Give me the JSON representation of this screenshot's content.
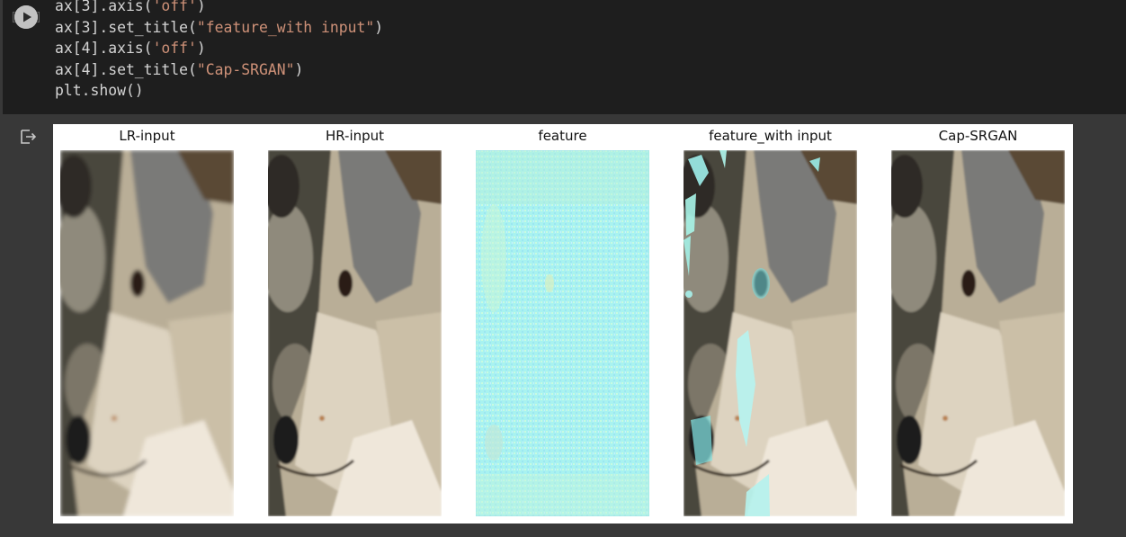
{
  "code_cell": {
    "run_button_icon": "play-icon",
    "lines": [
      {
        "parts": [
          {
            "t": "ax[3].axis("
          },
          {
            "t": "'off'",
            "s": 1
          },
          {
            "t": ")"
          }
        ]
      },
      {
        "parts": [
          {
            "t": "ax[3].set_title("
          },
          {
            "t": "\"feature_with input\"",
            "s": 1
          },
          {
            "t": ")"
          }
        ]
      },
      {
        "parts": [
          {
            "t": "ax[4].axis("
          },
          {
            "t": "'off'",
            "s": 1
          },
          {
            "t": ")"
          }
        ]
      },
      {
        "parts": [
          {
            "t": "ax[4].set_title("
          },
          {
            "t": "\"Cap-SRGAN\"",
            "s": 1
          },
          {
            "t": ")"
          }
        ]
      },
      {
        "parts": [
          {
            "t": "plt.show()"
          }
        ]
      }
    ]
  },
  "output": {
    "icon": "output-icon",
    "panels": [
      {
        "title": "LR-input",
        "style": "wolf-blur"
      },
      {
        "title": "HR-input",
        "style": "wolf"
      },
      {
        "title": "feature",
        "style": "feature-map"
      },
      {
        "title": "feature_with input",
        "style": "wolf-cyan"
      },
      {
        "title": "Cap-SRGAN",
        "style": "wolf"
      }
    ]
  },
  "colors": {
    "editor_bg": "#1e1e1e",
    "page_bg": "#383838",
    "string": "#ce9178",
    "code_text": "#d4d4d4",
    "feature_cyan": "#a8f2f0"
  }
}
